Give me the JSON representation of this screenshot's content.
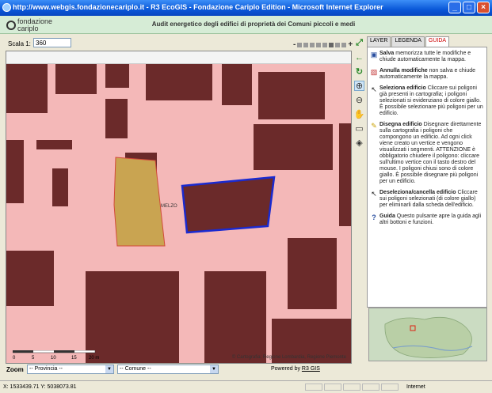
{
  "window": {
    "title": "http://www.webgis.fondazionecariplo.it - R3 EcoGIS - Fondazione Cariplo Edition - Microsoft Internet Explorer"
  },
  "header": {
    "logo_line1": "fondazione",
    "logo_line2": "cariplo",
    "title": "Audit energetico degli edifici di proprietà dei Comuni piccoli e medi"
  },
  "toolbar": {
    "scale_label": "Scala 1:",
    "scale_value": "360",
    "zoom_minus": "-",
    "zoom_plus": "+"
  },
  "map": {
    "place_label": "MELZO",
    "scale_ticks": [
      "0",
      "5",
      "10",
      "15",
      "20 m"
    ],
    "credits": "© Cartografia: Regione Lombardia, Regione Piemonte",
    "colors": {
      "background": "#f4b8b8",
      "building": "#6b2a2a",
      "selected": "#c9a451",
      "road": "#f0a8a8"
    }
  },
  "panel": {
    "tabs": [
      "LAYER",
      "LEGENDA",
      "GUIDA"
    ],
    "active_tab": "GUIDA",
    "items": [
      {
        "icon": "save-icon",
        "title": "Salva",
        "text": " memorizza tutte le modifiche e chiude automaticamente la mappa."
      },
      {
        "icon": "cancel-icon",
        "title": "Annulla modifiche",
        "text": " non salva e chiude automaticamente la mappa."
      },
      {
        "icon": "select-building-icon",
        "title": "Seleziona edificio",
        "text": " Cliccare sui poligoni già presenti in cartografia; i poligoni selezionati si evidenziano di colore giallo. È possibile selezionare più poligoni per un edificio."
      },
      {
        "icon": "draw-building-icon",
        "title": "Disegna edificio",
        "text": " Disegnare direttamente sulla cartografia i poligoni che compongono un edificio. Ad ogni click viene creato un vertice e vengono visualizzati i segmenti. ATTENZIONE è obbligatorio chiudere il poligono: cliccare sull'ultimo vertice con il tasto destro del mouse. I poligoni chiusi sono di colore giallo. È possibile disegnare più poligoni per un edificio."
      },
      {
        "icon": "deselect-icon",
        "title": "Deseleziona/cancella edificio",
        "text": " Cliccare sui poligoni selezionati (di colore giallo) per eliminarli dalla scheda dell'edificio."
      },
      {
        "icon": "help-icon",
        "title": "Guida",
        "text": " Questo pulsante apre la guida agli altri bottoni e funzioni."
      }
    ]
  },
  "bottom": {
    "zoom_label": "Zoom",
    "provincia": "-- Provincia --",
    "comune": "-- Comune --",
    "powered_prefix": "Powered by ",
    "powered_link": "R3 GIS"
  },
  "statusbar": {
    "coords": "X: 1533439.71  Y: 5038073.81",
    "zone": "Internet"
  }
}
